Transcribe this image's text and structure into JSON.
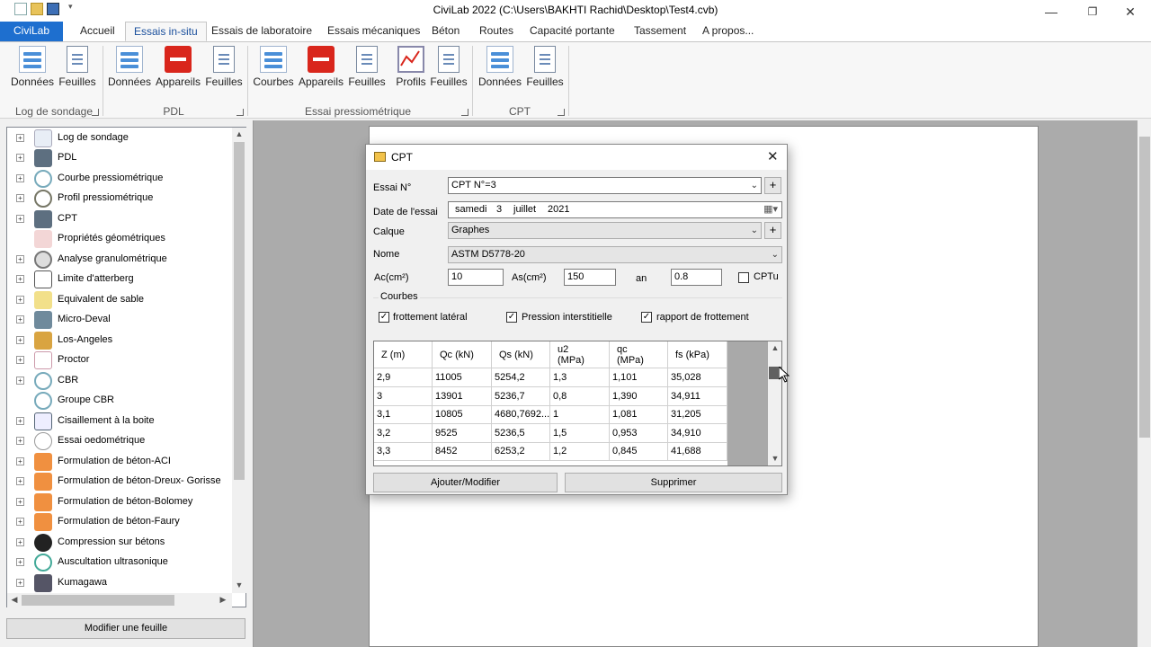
{
  "window": {
    "title": "CiviLab 2022 (C:\\Users\\BAKHTI Rachid\\Desktop\\Test4.cvb)"
  },
  "menu": {
    "app": "CiviLab",
    "tabs": [
      "Accueil",
      "Essais in-situ",
      "Essais de laboratoire",
      "Essais mécaniques",
      "Béton",
      "Routes",
      "Capacité portante",
      "Tassement",
      "A propos..."
    ]
  },
  "ribbon": {
    "groups": [
      {
        "label": "Log de sondage",
        "buttons": [
          "Données",
          "Feuilles"
        ]
      },
      {
        "label": "PDL",
        "buttons": [
          "Données",
          "Appareils",
          "Feuilles"
        ]
      },
      {
        "label": "Essai pressiométrique",
        "buttons": [
          "Courbes",
          "Appareils",
          "Feuilles",
          "Profils",
          "Feuilles"
        ]
      },
      {
        "label": "CPT",
        "buttons": [
          "Données",
          "Feuilles"
        ]
      }
    ]
  },
  "tree": {
    "items": [
      "Log de sondage",
      "PDL",
      "Courbe pressiométrique",
      "Profil pressiométrique",
      "CPT",
      "Propriétés géométriques",
      "Analyse granulométrique",
      "Limite d'atterberg",
      "Equivalent de sable",
      "Micro-Deval",
      "Los-Angeles",
      "Proctor",
      "CBR",
      "Groupe CBR",
      "Cisaillement à la boite",
      "Essai oedométrique",
      "Formulation de béton-ACI",
      "Formulation de béton-Dreux- Gorisse",
      "Formulation de béton-Bolomey",
      "Formulation de béton-Faury",
      "Compression sur bétons",
      "Auscultation ultrasonique",
      "Kumagawa"
    ],
    "button": "Modifier une feuille"
  },
  "dialog": {
    "title": "CPT",
    "essai_label": "Essai N°",
    "essai_value": "CPT N°=3",
    "date_label": "Date de l'essai",
    "date_day": "samedi",
    "date_num": "3",
    "date_month": "juillet",
    "date_year": "2021",
    "calque_label": "Calque",
    "calque_value": "Graphes",
    "nom_label": "Nome",
    "nom_value": "ASTM D5778-20",
    "ac_label": "Ac(cm²)",
    "ac_value": "10",
    "as_label": "As(cm²)",
    "as_value": "150",
    "an_label": "an",
    "an_value": "0.8",
    "cptu_label": "CPTu",
    "courbes_label": "Courbes",
    "checks": [
      "frottement latéral",
      "Pression interstitielle",
      "rapport de frottement"
    ],
    "plus": "+",
    "grid": {
      "headers": [
        "Z (m)",
        "Qc (kN)",
        "Qs (kN)",
        "u2\n(MPa)",
        "qc\n(MPa)",
        "fs (kPa)"
      ],
      "rows": [
        [
          "2,9",
          "11005",
          "5254,2",
          "1,3",
          "1,101",
          "35,028"
        ],
        [
          "3",
          "13901",
          "5236,7",
          "0,8",
          "1,390",
          "34,911"
        ],
        [
          "3,1",
          "10805",
          "4680,7692...",
          "1",
          "1,081",
          "31,205"
        ],
        [
          "3,2",
          "9525",
          "5236,5",
          "1,5",
          "0,953",
          "34,910"
        ],
        [
          "3,3",
          "8452",
          "6253,2",
          "1,2",
          "0,845",
          "41,688"
        ]
      ]
    },
    "btn_add": "Ajouter/Modifier",
    "btn_delete": "Supprimer"
  }
}
